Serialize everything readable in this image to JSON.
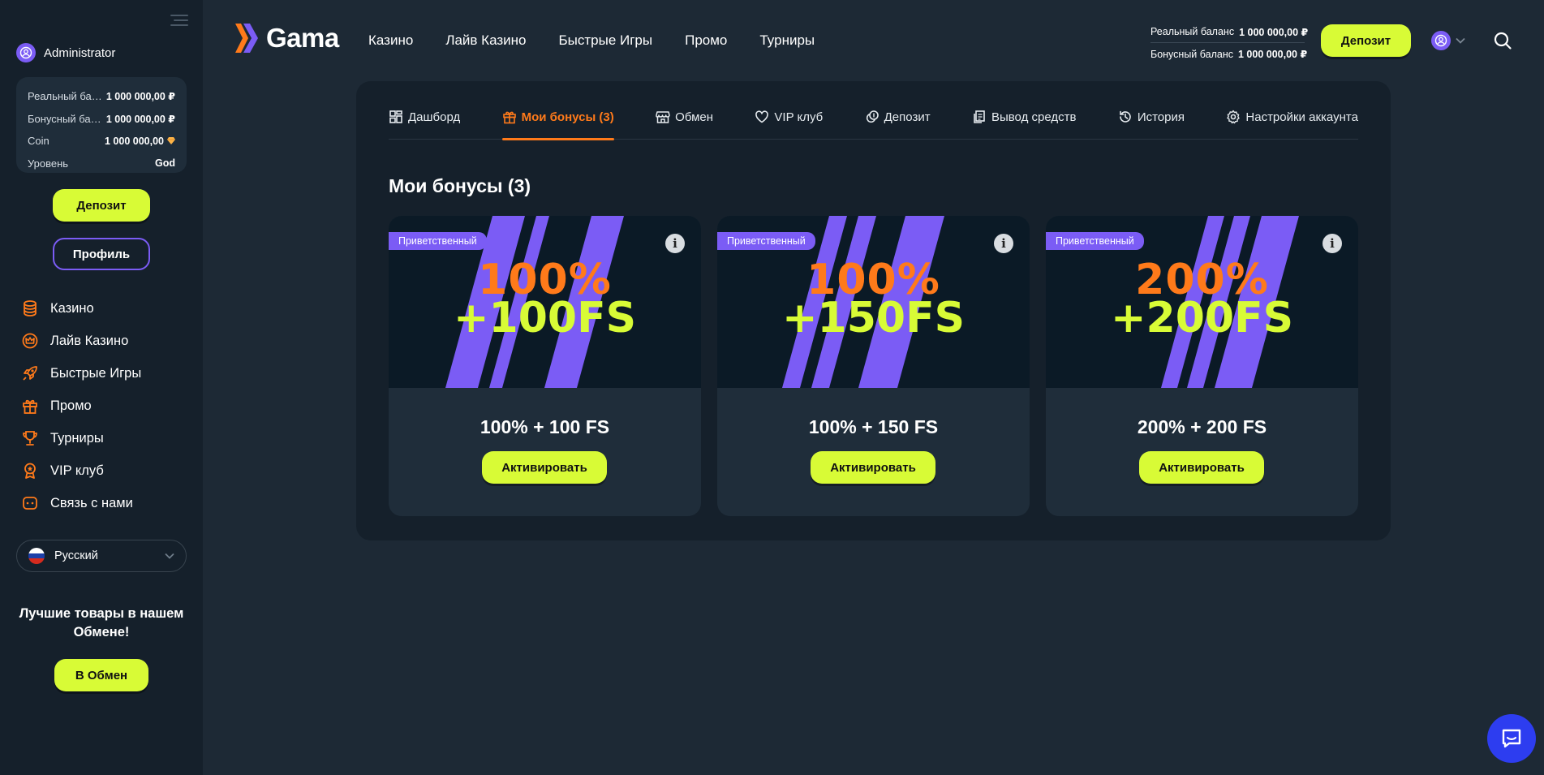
{
  "sidebar": {
    "username": "Administrator",
    "balances": [
      {
        "label": "Реальный баланс",
        "value": "1 000 000,00 ₽"
      },
      {
        "label": "Бонусный баланс",
        "value": "1 000 000,00 ₽"
      },
      {
        "label": "Coin",
        "value": "1 000 000,00"
      },
      {
        "label": "Уровень",
        "value": "God"
      }
    ],
    "deposit_label": "Депозит",
    "profile_label": "Профиль",
    "nav": [
      {
        "label": "Казино",
        "icon": "coins-icon"
      },
      {
        "label": "Лайв Казино",
        "icon": "crown-icon"
      },
      {
        "label": "Быстрые Игры",
        "icon": "rocket-icon"
      },
      {
        "label": "Промо",
        "icon": "gift-icon"
      },
      {
        "label": "Турниры",
        "icon": "trophy-icon"
      },
      {
        "label": "VIP клуб",
        "icon": "medal-icon"
      },
      {
        "label": "Связь с нами",
        "icon": "chat-icon"
      }
    ],
    "language": "Русский",
    "promo_text": "Лучшие товары в нашем Обмене!",
    "exchange_label": "В Обмен"
  },
  "header": {
    "logo_text": "Gama",
    "nav": [
      "Казино",
      "Лайв Казино",
      "Быстрые Игры",
      "Промо",
      "Турниры"
    ],
    "real_balance_label": "Реальный баланс",
    "real_balance_value": "1 000 000,00 ₽",
    "bonus_balance_label": "Бонусный баланс",
    "bonus_balance_value": "1 000 000,00 ₽",
    "deposit_label": "Депозит"
  },
  "tabs": [
    {
      "label": "Дашборд",
      "icon": "dashboard-icon",
      "active": false
    },
    {
      "label": "Мои бонусы (3)",
      "icon": "gift-icon",
      "active": true
    },
    {
      "label": "Обмен",
      "icon": "store-icon",
      "active": false
    },
    {
      "label": "VIP клуб",
      "icon": "heart-icon",
      "active": false
    },
    {
      "label": "Депозит",
      "icon": "coin-stack-icon",
      "active": false
    },
    {
      "label": "Вывод средств",
      "icon": "documents-icon",
      "active": false
    },
    {
      "label": "История",
      "icon": "history-icon",
      "active": false
    },
    {
      "label": "Настройки аккаунта",
      "icon": "gear-icon",
      "active": false
    }
  ],
  "section_title": "Мои бонусы (3)",
  "bonuses": [
    {
      "badge": "Приветственный",
      "banner_line1": "100%",
      "banner_line2": "+100FS",
      "title": "100% + 100 FS",
      "button": "Активировать"
    },
    {
      "badge": "Приветственный",
      "banner_line1": "100%",
      "banner_line2": "+150FS",
      "title": "100% + 150 FS",
      "button": "Активировать"
    },
    {
      "badge": "Приветственный",
      "banner_line1": "200%",
      "banner_line2": "+200FS",
      "title": "200% + 200 FS",
      "button": "Активировать"
    }
  ],
  "colors": {
    "accent_lime": "#d8fb36",
    "accent_orange": "#ff7a1a",
    "accent_purple": "#7b5cf5",
    "background": "#1d2935",
    "panel": "#15202b"
  }
}
